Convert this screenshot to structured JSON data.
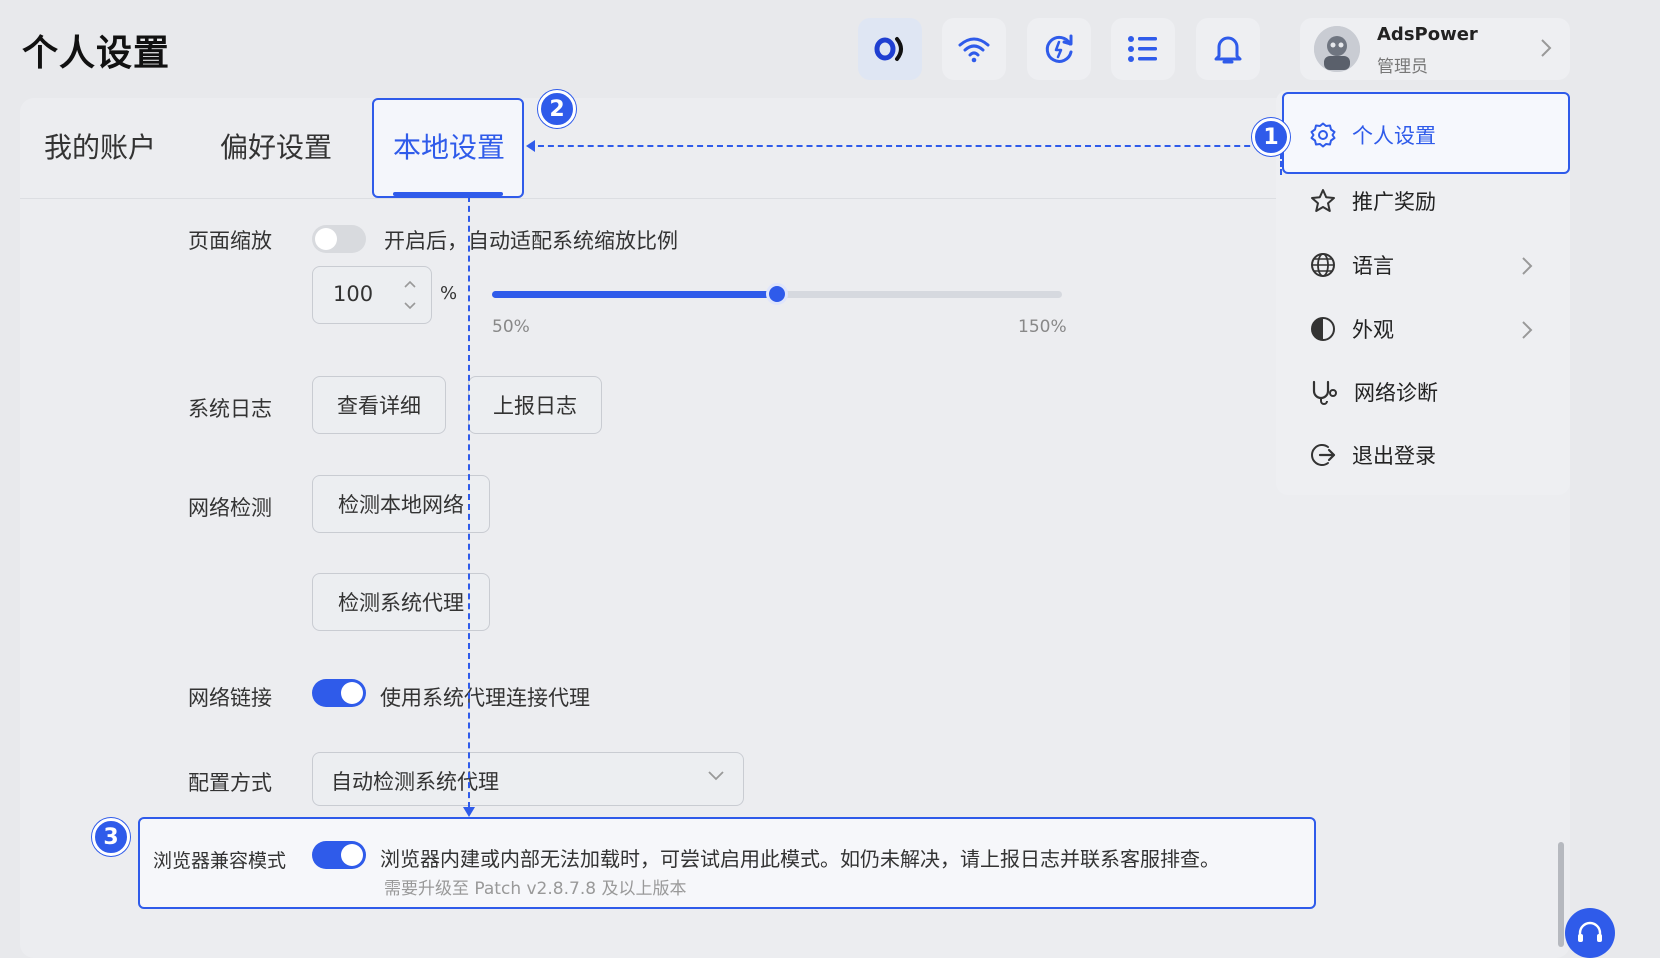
{
  "header": {
    "title": "个人设置",
    "user": {
      "name": "AdsPower",
      "role": "管理员"
    }
  },
  "tabs": [
    {
      "label": "我的账户"
    },
    {
      "label": "偏好设置"
    },
    {
      "label": "本地设置",
      "active": true
    }
  ],
  "settings": {
    "page_zoom": {
      "label": "页面缩放",
      "toggle_on": false,
      "toggle_text": "开启后，自动适配系统缩放比例",
      "value": "100",
      "unit": "%",
      "slider_value": 100,
      "slider_min": 50,
      "slider_max": 150,
      "min_label": "50%",
      "max_label": "150%"
    },
    "system_log": {
      "label": "系统日志",
      "view_btn": "查看详细",
      "report_btn": "上报日志"
    },
    "network_check": {
      "label": "网络检测",
      "local_btn": "检测本地网络",
      "proxy_btn": "检测系统代理"
    },
    "network_link": {
      "label": "网络链接",
      "toggle_on": true,
      "toggle_text": "使用系统代理连接代理"
    },
    "config_mode": {
      "label": "配置方式",
      "selected": "自动检测系统代理"
    },
    "browser_compat": {
      "label": "浏览器兼容模式",
      "toggle_on": true,
      "desc": "浏览器内建或内部无法加载时，可尝试启用此模式。如仍未解决，请上报日志并联系客服排查。",
      "note": "需要升级至 Patch v2.8.7.8 及以上版本"
    }
  },
  "dropdown": {
    "items": [
      {
        "label": "个人设置",
        "icon": "gear-icon",
        "active": true
      },
      {
        "label": "推广奖励",
        "icon": "star-icon"
      },
      {
        "label": "语言",
        "icon": "globe-icon",
        "submenu": true
      },
      {
        "label": "外观",
        "icon": "appearance-icon",
        "submenu": true
      },
      {
        "label": "网络诊断",
        "icon": "stethoscope-icon"
      },
      {
        "label": "退出登录",
        "icon": "logout-icon"
      }
    ]
  },
  "markers": [
    "1",
    "2",
    "3"
  ],
  "colors": {
    "accent": "#2f5bea",
    "background": "#e8e9ec"
  }
}
